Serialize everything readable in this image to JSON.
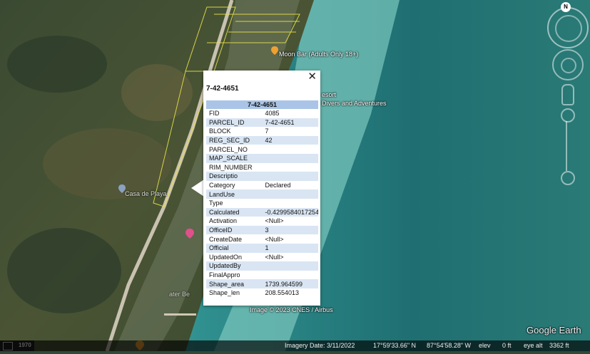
{
  "map": {
    "places": [
      {
        "name": "Moon Bar (Adults Only 18+)"
      },
      {
        "name": "esort"
      },
      {
        "name": "Divers and Adventures"
      },
      {
        "name": "Casa de Playa"
      },
      {
        "name": "ater Be"
      }
    ],
    "imagery_credit": "Image © 2023 CNES / Airbus",
    "brand": "Google Earth",
    "scale_year": "1970",
    "compass_letter": "N"
  },
  "popup": {
    "title": "7-42-4651",
    "table_header": "7-42-4651",
    "close_symbol": "✕",
    "rows": [
      {
        "key": "FID",
        "value": "4085"
      },
      {
        "key": "PARCEL_ID",
        "value": "7-42-4651"
      },
      {
        "key": "BLOCK",
        "value": "7"
      },
      {
        "key": "REG_SEC_ID",
        "value": "42"
      },
      {
        "key": "PARCEL_NO",
        "value": ""
      },
      {
        "key": "MAP_SCALE",
        "value": ""
      },
      {
        "key": "RIM_NUMBER",
        "value": ""
      },
      {
        "key": "Descriptio",
        "value": ""
      },
      {
        "key": "Category",
        "value": "Declared"
      },
      {
        "key": "LandUse",
        "value": ""
      },
      {
        "key": "Type",
        "value": ""
      },
      {
        "key": "Calculated",
        "value": "-0.429958401725465"
      },
      {
        "key": "Activation",
        "value": "<Null>"
      },
      {
        "key": "OfficeID",
        "value": "3"
      },
      {
        "key": "CreateDate",
        "value": "<Null>"
      },
      {
        "key": "Official",
        "value": "1"
      },
      {
        "key": "UpdatedOn",
        "value": "<Null>"
      },
      {
        "key": "UpdatedBy",
        "value": ""
      },
      {
        "key": "FinalAppro",
        "value": ""
      },
      {
        "key": "Shape_area",
        "value": "1739.964599"
      },
      {
        "key": "Shape_len",
        "value": "208.554013"
      }
    ]
  },
  "status": {
    "imagery_date": "Imagery Date: 3/11/2022",
    "lat": "17°59'33.66\" N",
    "lon": "87°54'58.28\" W",
    "elev_label": "elev",
    "elev_value": "0 ft",
    "eye_alt_label": "eye alt",
    "eye_alt_value": "3362 ft"
  },
  "colors": {
    "table_header_bg": "#a9c4e6",
    "row_alt_bg": "#d9e5f3",
    "parcel_outline": "#e8e04a",
    "pin_orange": "#f0a030",
    "pin_pink": "#e0508a"
  }
}
